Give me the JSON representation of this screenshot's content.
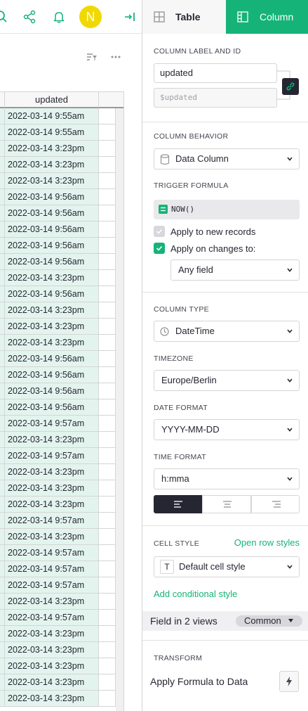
{
  "grid": {
    "column_label": "updated",
    "rows": [
      "2022-03-14 9:55am",
      "2022-03-14 9:55am",
      "2022-03-14 3:23pm",
      "2022-03-14 3:23pm",
      "2022-03-14 3:23pm",
      "2022-03-14 9:56am",
      "2022-03-14 9:56am",
      "2022-03-14 9:56am",
      "2022-03-14 9:56am",
      "2022-03-14 9:56am",
      "2022-03-14 3:23pm",
      "2022-03-14 9:56am",
      "2022-03-14 3:23pm",
      "2022-03-14 3:23pm",
      "2022-03-14 3:23pm",
      "2022-03-14 9:56am",
      "2022-03-14 9:56am",
      "2022-03-14 9:56am",
      "2022-03-14 9:56am",
      "2022-03-14 9:57am",
      "2022-03-14 3:23pm",
      "2022-03-14 9:57am",
      "2022-03-14 3:23pm",
      "2022-03-14 3:23pm",
      "2022-03-14 3:23pm",
      "2022-03-14 9:57am",
      "2022-03-14 3:23pm",
      "2022-03-14 9:57am",
      "2022-03-14 9:57am",
      "2022-03-14 9:57am",
      "2022-03-14 3:23pm",
      "2022-03-14 9:57am",
      "2022-03-14 3:23pm",
      "2022-03-14 3:23pm",
      "2022-03-14 3:23pm",
      "2022-03-14 3:23pm",
      "2022-03-14 3:23pm"
    ]
  },
  "topbar": {
    "avatar_initial": "N",
    "icons": [
      "search-icon",
      "share-icon",
      "bell-icon",
      "avatar",
      "logout-icon"
    ]
  },
  "panel": {
    "tabs": {
      "table": "Table",
      "column": "Column"
    },
    "column_label_section": "COLUMN LABEL AND ID",
    "label_value": "updated",
    "id_value": "$updated",
    "behavior_section": "COLUMN BEHAVIOR",
    "behavior_value": "Data Column",
    "trigger_section": "TRIGGER FORMULA",
    "trigger_formula": "NOW()",
    "apply_new_records": "Apply to new records",
    "apply_on_changes": "Apply on changes to:",
    "changes_target": "Any field",
    "type_section": "COLUMN TYPE",
    "type_value": "DateTime",
    "timezone_section": "TIMEZONE",
    "timezone_value": "Europe/Berlin",
    "date_format_section": "DATE FORMAT",
    "date_format_value": "YYYY-MM-DD",
    "time_format_section": "TIME FORMAT",
    "time_format_value": "h:mma",
    "cell_style_section": "CELL STYLE",
    "open_row_styles": "Open row styles",
    "cell_style_value": "Default cell style",
    "cell_style_glyph": "T",
    "add_conditional": "Add conditional style",
    "field_views": "Field in 2 views",
    "common": "Common",
    "transform_section": "TRANSFORM",
    "apply_formula": "Apply Formula to Data"
  },
  "colors": {
    "accent": "#16b378",
    "cell_bg": "#e3f4ee",
    "avatar": "#f0d800"
  }
}
